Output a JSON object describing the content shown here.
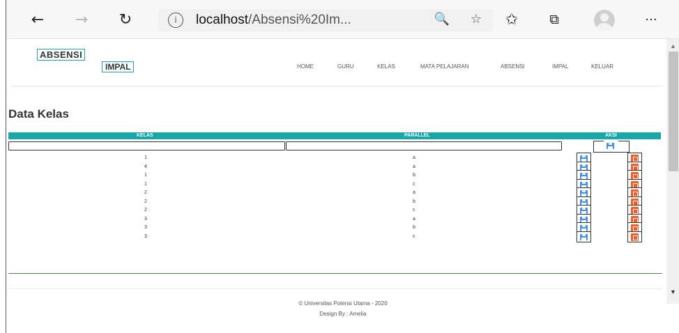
{
  "browser": {
    "url_host": "localhost",
    "url_path": "/Absensi%20Im...",
    "icons": [
      "back-icon",
      "forward-icon",
      "refresh-icon",
      "info-icon",
      "zoom-icon",
      "add-favorite-icon",
      "favorites-icon",
      "collections-icon",
      "profile-icon",
      "more-icon"
    ],
    "glyphs": {
      "back": "←",
      "forward": "→",
      "refresh": "↻",
      "info": "i",
      "zoom": "🔍",
      "star": "☆",
      "favorites": "✩",
      "collections": "⧉",
      "more": "···"
    }
  },
  "header": {
    "logo_line1": "ABSENSI",
    "logo_line2": "IMPAL",
    "nav": [
      "HOME",
      "GURU",
      "KELAS",
      "MATA PELAJARAN",
      "ABSENSI",
      "IMPAL",
      "KELUAR"
    ]
  },
  "page_title": "Data Kelas",
  "table": {
    "headers": [
      "KELAS",
      "PARALLEL",
      "AKSI"
    ],
    "rows": [
      {
        "kelas": "1",
        "parallel": "a"
      },
      {
        "kelas": "4",
        "parallel": "a"
      },
      {
        "kelas": "1",
        "parallel": "b"
      },
      {
        "kelas": "1",
        "parallel": "c"
      },
      {
        "kelas": "2",
        "parallel": "a"
      },
      {
        "kelas": "2",
        "parallel": "b"
      },
      {
        "kelas": "2",
        "parallel": "c"
      },
      {
        "kelas": "3",
        "parallel": "a"
      },
      {
        "kelas": "3",
        "parallel": "b"
      },
      {
        "kelas": "3",
        "parallel": "c"
      }
    ]
  },
  "footer": {
    "copyright": "© Universitas Potensi Utama - 2020",
    "design_by": "Design By : Amelia"
  },
  "colors": {
    "accent": "#19a6aa",
    "divider": "#3a8e3a",
    "save_icon": "#4a90e2",
    "delete_icon": "#f25c27"
  }
}
